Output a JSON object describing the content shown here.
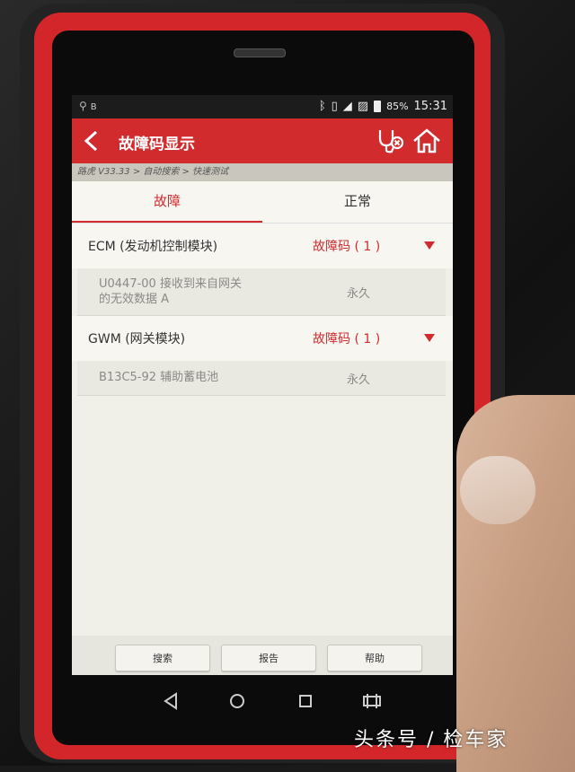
{
  "statusbar": {
    "battery": "85%",
    "time": "15:31"
  },
  "appbar": {
    "title": "故障码显示",
    "back_icon": "chevron-left-icon",
    "stethoscope_icon": "stethoscope-icon",
    "home_icon": "home-icon"
  },
  "breadcrumb": "路虎 V33.33 > 自动搜索 > 快速测试",
  "tabs": [
    {
      "label": "故障",
      "active": true
    },
    {
      "label": "正常",
      "active": false
    }
  ],
  "modules": [
    {
      "name": "ECM (发动机控制模块)",
      "count_label": "故障码 ( 1 )",
      "codes": [
        {
          "line1": "U0447-00 接收到来自网关",
          "line2": "的无效数据 A",
          "status": "永久"
        }
      ]
    },
    {
      "name": "GWM (网关模块)",
      "count_label": "故障码 ( 1 )",
      "codes": [
        {
          "line1": "B13C5-92 辅助蓄电池",
          "line2": "",
          "status": "永久"
        }
      ]
    }
  ],
  "buttons": {
    "search": "搜索",
    "report": "报告",
    "help": "帮助"
  },
  "colors": {
    "accent": "#d12b2e",
    "bezel": "#d3262a"
  },
  "watermark": "头条号 / 检车家"
}
